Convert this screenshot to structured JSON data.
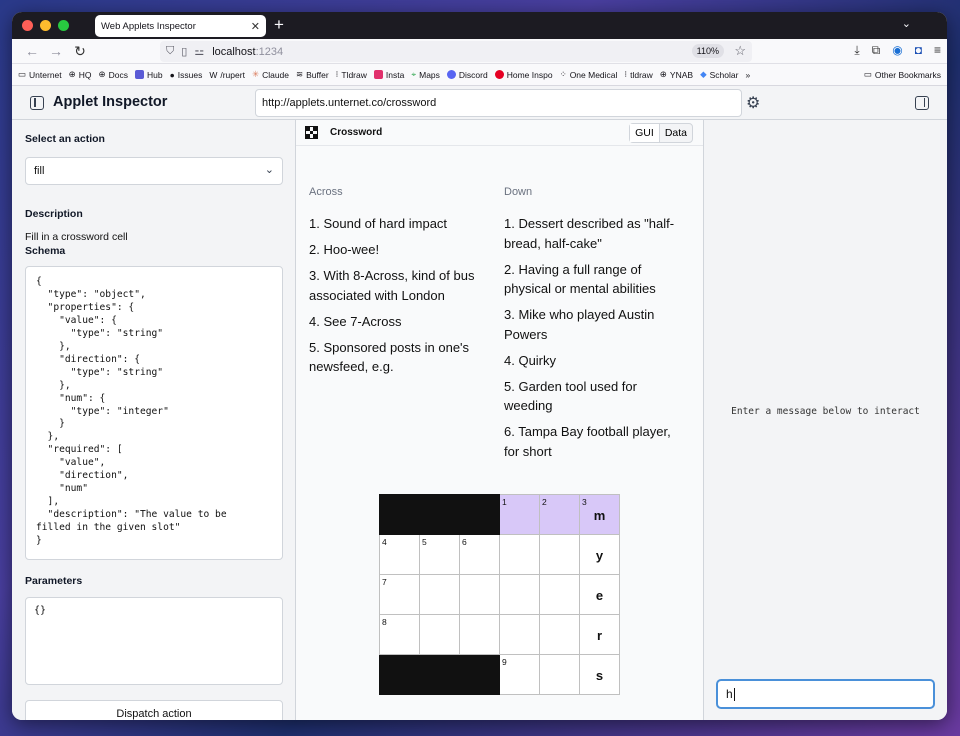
{
  "browser": {
    "tab_title": "Web Applets Inspector",
    "url_host": "localhost",
    "url_port": ":1234",
    "zoom": "110%",
    "bookmarks": [
      "Unternet",
      "HQ",
      "Docs",
      "Hub",
      "Issues",
      "/rupert",
      "Claude",
      "Buffer",
      "Tldraw",
      "Insta",
      "Maps",
      "Discord",
      "Home Inspo",
      "One Medical",
      "tldraw",
      "YNAB",
      "Scholar"
    ],
    "other_bookmarks": "Other Bookmarks"
  },
  "app": {
    "title": "Applet Inspector",
    "url": "http://applets.unternet.co/crossword"
  },
  "left": {
    "select_label": "Select an action",
    "selected_action": "fill",
    "description_label": "Description",
    "description": "Fill in a crossword cell",
    "schema_label": "Schema",
    "schema": "{\n  \"type\": \"object\",\n  \"properties\": {\n    \"value\": {\n      \"type\": \"string\"\n    },\n    \"direction\": {\n      \"type\": \"string\"\n    },\n    \"num\": {\n      \"type\": \"integer\"\n    }\n  },\n  \"required\": [\n    \"value\",\n    \"direction\",\n    \"num\"\n  ],\n  \"description\": \"The value to be\nfilled in the given slot\"\n}",
    "parameters_label": "Parameters",
    "parameters": "{}",
    "dispatch_label": "Dispatch action"
  },
  "middle": {
    "title": "Crossword",
    "toggle_gui": "GUI",
    "toggle_data": "Data",
    "across_label": "Across",
    "down_label": "Down",
    "across": [
      "1.  Sound of hard impact",
      "2.  Hoo-wee!",
      "3.  With 8-Across, kind of bus associated with London",
      "4.  See 7-Across",
      "5.  Sponsored posts in one's newsfeed, e.g."
    ],
    "down": [
      "1.  Dessert described as \"half-bread, half-cake\"",
      "2.  Having a full range of physical or mental abilities",
      "3.  Mike who played Austin Powers",
      "4.  Quirky",
      "5.  Garden tool used for weeding",
      "6.  Tampa Bay football player, for short"
    ],
    "grid": [
      [
        {
          "b": 1
        },
        {
          "b": 1
        },
        {
          "b": 1
        },
        {
          "n": "1",
          "h": 1
        },
        {
          "n": "2",
          "h": 1
        },
        {
          "n": "3",
          "h": 1,
          "l": "m"
        }
      ],
      [
        {
          "n": "4"
        },
        {
          "n": "5"
        },
        {
          "n": "6"
        },
        {},
        {},
        {
          "l": "y"
        }
      ],
      [
        {
          "n": "7"
        },
        {},
        {},
        {},
        {},
        {
          "l": "e"
        }
      ],
      [
        {
          "n": "8"
        },
        {},
        {},
        {},
        {},
        {
          "l": "r"
        }
      ],
      [
        {
          "b": 1
        },
        {
          "b": 1
        },
        {
          "b": 1
        },
        {
          "n": "9"
        },
        {},
        {
          "l": "s"
        }
      ]
    ]
  },
  "right": {
    "hint": "Enter a message below to interact",
    "message_value": "h"
  },
  "colors": {
    "highlight": "#d8c8f8",
    "focus_border": "#4a90d9"
  }
}
